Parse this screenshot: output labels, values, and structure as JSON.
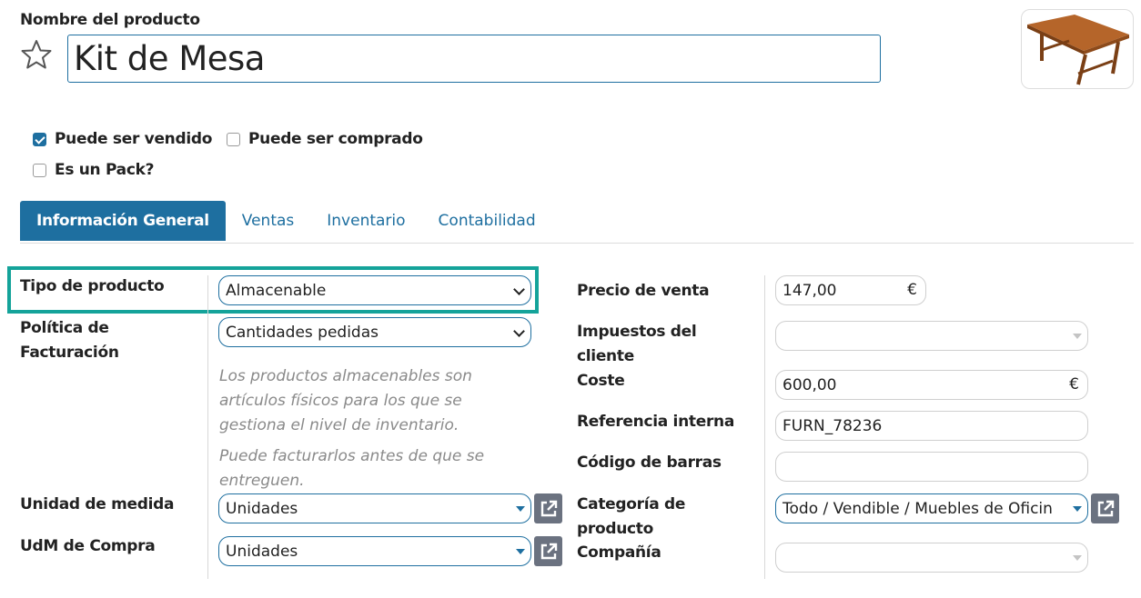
{
  "header": {
    "name_label": "Nombre del producto",
    "name_value": "Kit de Mesa",
    "favorite_icon": "star-icon",
    "image_icon": "table-image"
  },
  "options": {
    "can_be_sold": {
      "label": "Puede ser vendido",
      "checked": true
    },
    "can_be_purchased": {
      "label": "Puede ser comprado",
      "checked": false
    },
    "is_pack": {
      "label": "Es un Pack?",
      "checked": false
    }
  },
  "tabs": [
    {
      "label": "Información General",
      "active": true
    },
    {
      "label": "Ventas",
      "active": false
    },
    {
      "label": "Inventario",
      "active": false
    },
    {
      "label": "Contabilidad",
      "active": false
    }
  ],
  "left": {
    "product_type": {
      "label": "Tipo de producto",
      "value": "Almacenable"
    },
    "invoice_policy": {
      "label_line1": "Política de",
      "label_line2": "Facturación",
      "value": "Cantidades pedidas"
    },
    "help_text_1": [
      "Los productos almacenables son",
      "artículos físicos para los que se",
      "gestiona el nivel de inventario."
    ],
    "help_text_2": [
      "Puede facturarlos antes de que se",
      "entreguen."
    ],
    "uom": {
      "label": "Unidad de medida",
      "value": "Unidades"
    },
    "purchase_uom": {
      "label": "UdM de Compra",
      "value": "Unidades"
    }
  },
  "right": {
    "sale_price": {
      "label": "Precio de venta",
      "value": "147,00",
      "currency": "€"
    },
    "customer_taxes": {
      "label_line1": "Impuestos del",
      "label_line2": "cliente",
      "value": ""
    },
    "cost": {
      "label": "Coste",
      "value": "600,00",
      "currency": "€"
    },
    "internal_ref": {
      "label": "Referencia interna",
      "value": "FURN_78236"
    },
    "barcode": {
      "label": "Código de barras",
      "value": ""
    },
    "category": {
      "label_line1": "Categoría de",
      "label_line2": "producto",
      "value": "Todo / Vendible / Muebles de Oficin"
    },
    "company": {
      "label": "Compañía",
      "value": ""
    }
  },
  "colors": {
    "accent": "#1e6fa0",
    "highlight": "#14a39a",
    "external_button": "#6b7280"
  }
}
